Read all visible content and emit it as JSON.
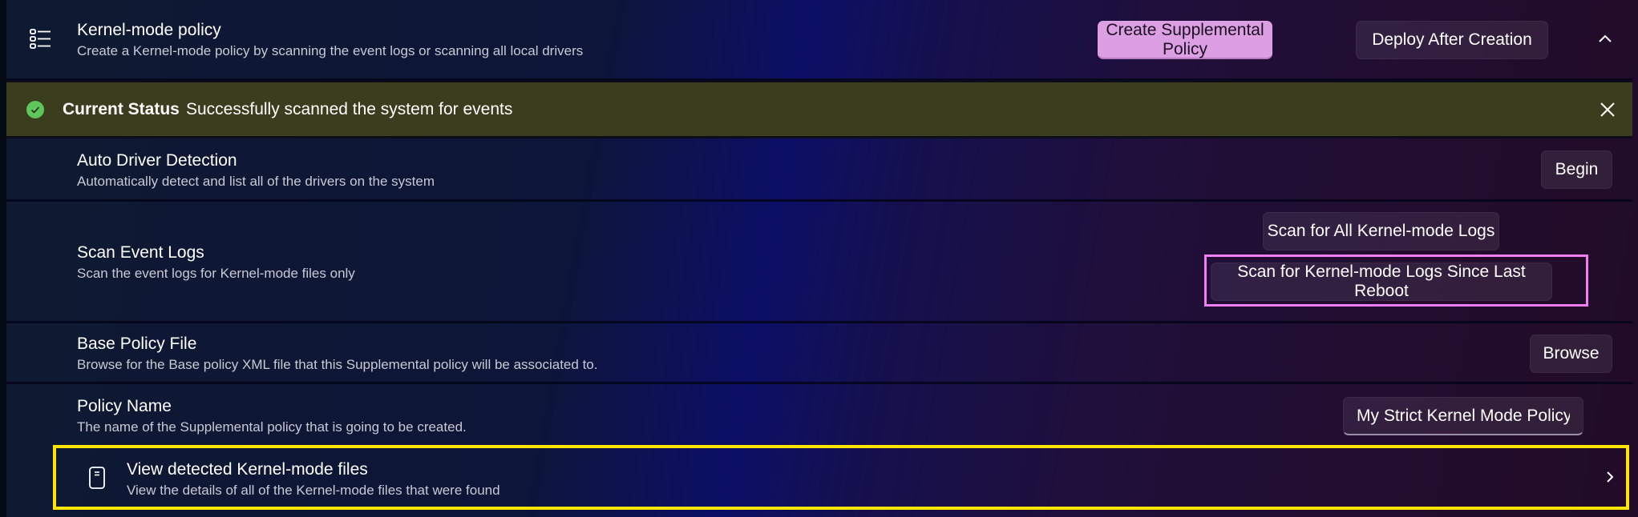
{
  "header": {
    "icon": "list-bullet-icon",
    "title": "Kernel-mode policy",
    "description": "Create a Kernel-mode policy by scanning the event logs or scanning all local drivers",
    "create_button": "Create Supplemental Policy",
    "deploy_button": "Deploy After Creation",
    "collapse_icon": "chevron-up-icon"
  },
  "status": {
    "icon": "check-circle-icon",
    "label": "Current Status",
    "message": "Successfully scanned the system for events",
    "close_icon": "close-icon",
    "background": "#3b3e1e",
    "icon_color": "#5ec65a"
  },
  "rows": {
    "auto_driver": {
      "title": "Auto Driver Detection",
      "description": "Automatically detect and list all of the drivers on the system",
      "button": "Begin"
    },
    "scan_event_logs": {
      "title": "Scan Event Logs",
      "description": "Scan the event logs for Kernel-mode files only",
      "button_all": "Scan for All Kernel-mode Logs",
      "button_since_reboot": "Scan for Kernel-mode Logs Since Last Reboot"
    },
    "base_policy": {
      "title": "Base Policy File",
      "description": "Browse for the Base policy XML file that this Supplemental policy will be associated to.",
      "button": "Browse"
    },
    "policy_name": {
      "title": "Policy Name",
      "description": "The name of the Supplemental policy that is going to be created.",
      "value": "My Strict Kernel Mode Policy"
    },
    "view_files": {
      "icon": "document-icon",
      "title": "View detected Kernel-mode files",
      "description": "View the details of all of the Kernel-mode files that were found",
      "chevron_icon": "chevron-right-icon"
    }
  },
  "colors": {
    "accent_button": "#dc9fe3",
    "highlight_pink": "#f37ef3",
    "highlight_yellow": "#ffe500"
  }
}
